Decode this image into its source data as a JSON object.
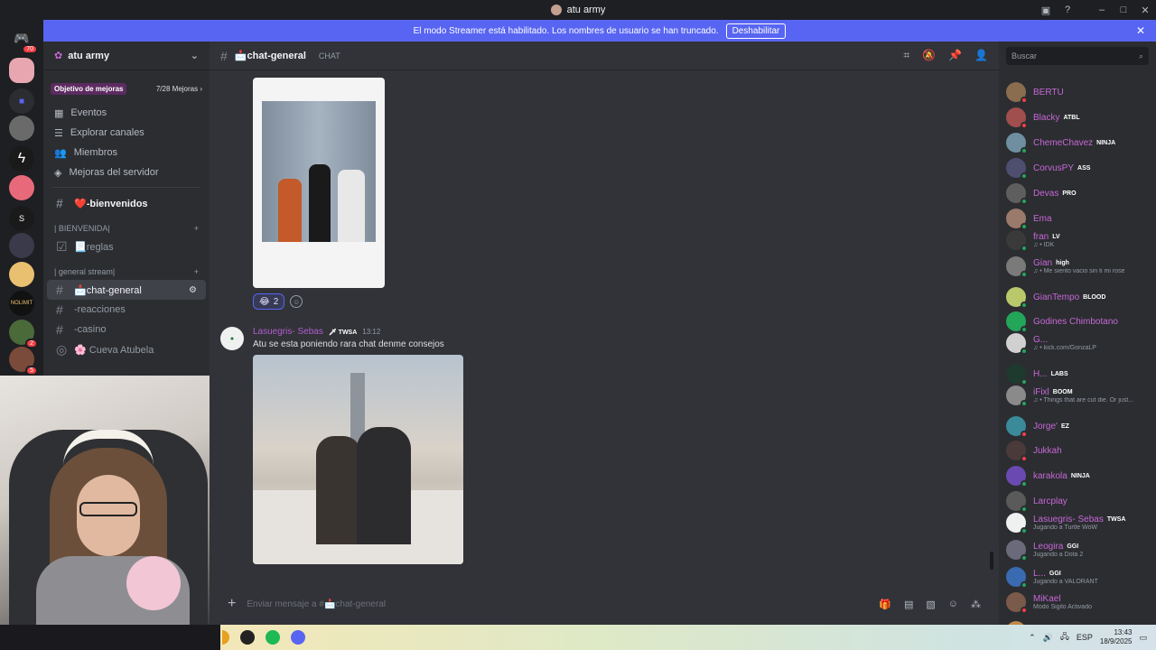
{
  "window": {
    "title": "atu army"
  },
  "banner": {
    "text": "El modo Streamer está habilitado. Los nombres de usuario se han truncado.",
    "disable_label": "Deshabilitar"
  },
  "servers": {
    "dm_badge": "70",
    "badge_a": "2",
    "badge_b": "5"
  },
  "guild": {
    "name": "atu army",
    "boost_label": "Objetivo de mejoras",
    "boost_progress": "7/28 Mejoras",
    "nav": [
      "Eventos",
      "Explorar canales",
      "Miembros",
      "Mejoras del servidor"
    ],
    "welcome_channel": "-bienvenidos",
    "cat1": "| BIENVENIDA|",
    "rules_channel": "reglas",
    "cat2": "| general stream|",
    "active_channel": "chat-general",
    "channels": [
      "-reacciones",
      "-casino",
      "Cueva Atubela"
    ]
  },
  "chat": {
    "channel_name": "chat-general",
    "channel_tag": "CHAT",
    "reaction_count": "2",
    "message": {
      "author": "Lasuegris- Sebas",
      "tag": "TWSA",
      "time": "13:12",
      "text": "Atu se esta poniendo rara chat denme consejos"
    },
    "input_placeholder": "Enviar mensaje a #📩chat-general"
  },
  "members": {
    "search_placeholder": "Buscar",
    "list": [
      {
        "name": "BERTU",
        "tag": "",
        "status": "",
        "color": "#c768d6",
        "avatar": "#8a6d4e",
        "dot": "#f23f43"
      },
      {
        "name": "Blacky",
        "tag": "ATBL",
        "status": "",
        "color": "#c768d6",
        "avatar": "#a04e4e",
        "dot": "#f23f43"
      },
      {
        "name": "ChemeChavez",
        "tag": "NINJA",
        "status": "",
        "color": "#c768d6",
        "avatar": "#6f8fa0",
        "dot": "#23a55a"
      },
      {
        "name": "CorvusPY",
        "tag": "ASS",
        "status": "",
        "color": "#c768d6",
        "avatar": "#4e4e6f",
        "dot": "#23a55a"
      },
      {
        "name": "Devas",
        "tag": "PRO",
        "status": "",
        "color": "#c768d6",
        "avatar": "#5e5e5e",
        "dot": "#23a55a"
      },
      {
        "name": "Ema",
        "tag": "",
        "status": "",
        "color": "#c768d6",
        "avatar": "#9a7a6a",
        "dot": "#23a55a"
      },
      {
        "name": "fran",
        "tag": "LV",
        "status": "♫ • IDK",
        "color": "#c768d6",
        "avatar": "#3a3a3a",
        "dot": "#23a55a"
      },
      {
        "name": "Gian",
        "tag": "high",
        "status": "♫ • Me siento vacio sin ti mi rose",
        "color": "#c768d6",
        "avatar": "#7a7a7a",
        "dot": "#23a55a"
      },
      {
        "name": "GianTempo",
        "tag": "BLOOD",
        "status": "",
        "color": "#c768d6",
        "avatar": "#b8c86a",
        "dot": "#23a55a"
      },
      {
        "name": "Godines Chimbotano",
        "tag": "",
        "status": "",
        "color": "#c768d6",
        "avatar": "#23a55a",
        "dot": "#23a55a"
      },
      {
        "name": "G...",
        "tag": "",
        "status": "♫ • kick.com/GonzaLP",
        "color": "#c768d6",
        "avatar": "#d0d0d0",
        "dot": "#23a55a"
      },
      {
        "name": "H...",
        "tag": "LABS",
        "status": "",
        "color": "#c768d6",
        "avatar": "#1e3a2e",
        "dot": "#23a55a"
      },
      {
        "name": "iFixl",
        "tag": "BOOM",
        "status": "♫ • Things that are cut die. Or just...",
        "color": "#c768d6",
        "avatar": "#8a8a8a",
        "dot": "#23a55a"
      },
      {
        "name": "Jorge'",
        "tag": "EZ",
        "status": "",
        "color": "#c768d6",
        "avatar": "#3a8a9a",
        "dot": "#f23f43"
      },
      {
        "name": "Jukkah",
        "tag": "",
        "status": "",
        "color": "#c768d6",
        "avatar": "#4a3a3a",
        "dot": "#f23f43"
      },
      {
        "name": "karakola",
        "tag": "NINJA",
        "status": "",
        "color": "#c768d6",
        "avatar": "#6a4ab0",
        "dot": "#23a55a"
      },
      {
        "name": "Larcplay",
        "tag": "",
        "status": "",
        "color": "#c768d6",
        "avatar": "#5a5a5a",
        "dot": "#23a55a"
      },
      {
        "name": "Lasuegris- Sebas",
        "tag": "TWSA",
        "status": "Jugando a Turtle WoW",
        "color": "#c768d6",
        "avatar": "#eef1ef",
        "dot": "#23a55a"
      },
      {
        "name": "Leogira",
        "tag": "GGI",
        "status": "Jugando a Dota 2",
        "color": "#c768d6",
        "avatar": "#6a6a7a",
        "dot": "#23a55a"
      },
      {
        "name": "L...",
        "tag": "GGI",
        "status": "Jugando a VALORANT",
        "color": "#c768d6",
        "avatar": "#3a6ab0",
        "dot": "#23a55a"
      },
      {
        "name": "MiKael",
        "tag": "",
        "status": "Modo Sigilo Activado",
        "color": "#c768d6",
        "avatar": "#7a5a4a",
        "dot": "#f23f43"
      },
      {
        "name": "Naruto Goldberg",
        "tag": "ATBL",
        "status": "",
        "color": "#c768d6",
        "avatar": "#c08a4a",
        "dot": "#23a55a"
      }
    ]
  },
  "taskbar": {
    "lang": "ESP",
    "time": "13:43",
    "date": "18/9/2025"
  }
}
